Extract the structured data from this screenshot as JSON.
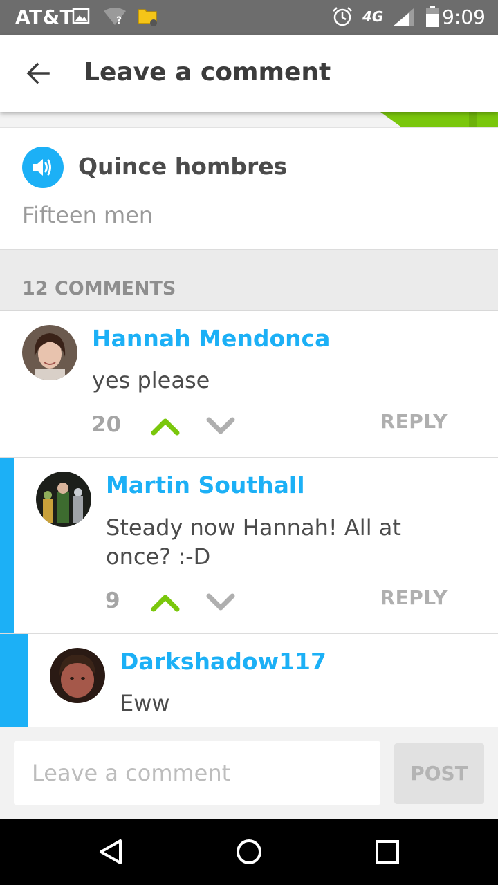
{
  "status_bar": {
    "carrier": "AT&T",
    "time": "9:09",
    "network": "4G"
  },
  "app_bar": {
    "title": "Leave a comment",
    "back_icon": "arrow-left-icon"
  },
  "sentence": {
    "native": "Quince hombres",
    "translation": "Fifteen men",
    "speaker_icon": "speaker-icon"
  },
  "comments_header": "12 COMMENTS",
  "comments": [
    {
      "author": "Hannah Mendonca",
      "text": "yes please",
      "votes": "20",
      "reply_label": "REPLY"
    },
    {
      "author": "Martin Southall",
      "text": "Steady now Hannah! All at once? :-D",
      "votes": "9",
      "reply_label": "REPLY"
    },
    {
      "author": "Darkshadow117",
      "text": "Eww"
    }
  ],
  "composer": {
    "placeholder": "Leave a comment",
    "post_label": "POST"
  },
  "colors": {
    "accent_blue": "#1cb0f6",
    "upvote_green": "#7ac70c",
    "statusbar": "#6d6d6d"
  }
}
